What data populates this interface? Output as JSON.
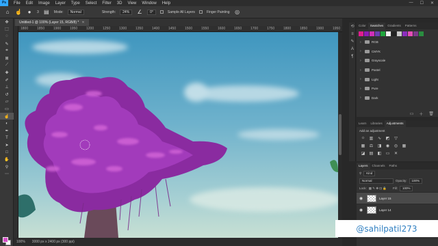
{
  "app": {
    "logo": "Ps"
  },
  "menu": [
    "File",
    "Edit",
    "Image",
    "Layer",
    "Type",
    "Select",
    "Filter",
    "3D",
    "View",
    "Window",
    "Help"
  ],
  "window_controls": [
    "—",
    "☐",
    "✕"
  ],
  "options_bar": {
    "brush_size": "3",
    "mode_label": "Mode:",
    "mode_value": "Normal",
    "strength_label": "Strength:",
    "strength_value": "24%",
    "angle_value": "0°",
    "sample_all_layers": "Sample All Layers",
    "finger_painting": "Finger Painting"
  },
  "document": {
    "tab_title": "Untitled-1 @ 100% (Layer 15, RGB/8) *",
    "ruler_ticks": [
      "1800",
      "1850",
      "1900",
      "1950",
      "1200",
      "1250",
      "1300",
      "1350",
      "1400",
      "1450",
      "1500",
      "1550",
      "1600",
      "1650",
      "1700",
      "1750",
      "1800",
      "1850",
      "1900",
      "1950"
    ]
  },
  "status": {
    "zoom": "100%",
    "doc_info": "3000 px x 2400 px (300 ppi)"
  },
  "swatches_panel": {
    "tabs": [
      "Color",
      "Swatches",
      "Gradients",
      "Patterns"
    ],
    "active_tab": "Swatches",
    "colors": [
      "#e11d8f",
      "#8e1bb5",
      "#d02fb8",
      "#6a3fb0",
      "#20a63d",
      "#f0f0f0",
      "#222222",
      "#c9c9c9",
      "#8c2dbf",
      "#e54db7",
      "#7e3a8a",
      "#2a8e40"
    ],
    "folders": [
      "RGB",
      "CMYK",
      "Grayscale",
      "Pastel",
      "Light",
      "Pure",
      "Dark"
    ]
  },
  "adjustments_panel": {
    "tabs": [
      "Learn",
      "Libraries",
      "Adjustments"
    ],
    "active_tab": "Adjustments",
    "title": "Add an adjustment"
  },
  "layers_panel": {
    "tabs": [
      "Layers",
      "Channels",
      "Paths"
    ],
    "active_tab": "Layers",
    "kind_label": "Kind",
    "blend_mode": "Normal",
    "opacity_label": "Opacity:",
    "opacity_value": "100%",
    "lock_label": "Lock:",
    "fill_label": "Fill:",
    "fill_value": "100%",
    "layers": [
      {
        "name": "Layer 15",
        "selected": true
      },
      {
        "name": "Layer 14",
        "selected": false
      }
    ]
  },
  "watermark": "@sahilpatil273"
}
